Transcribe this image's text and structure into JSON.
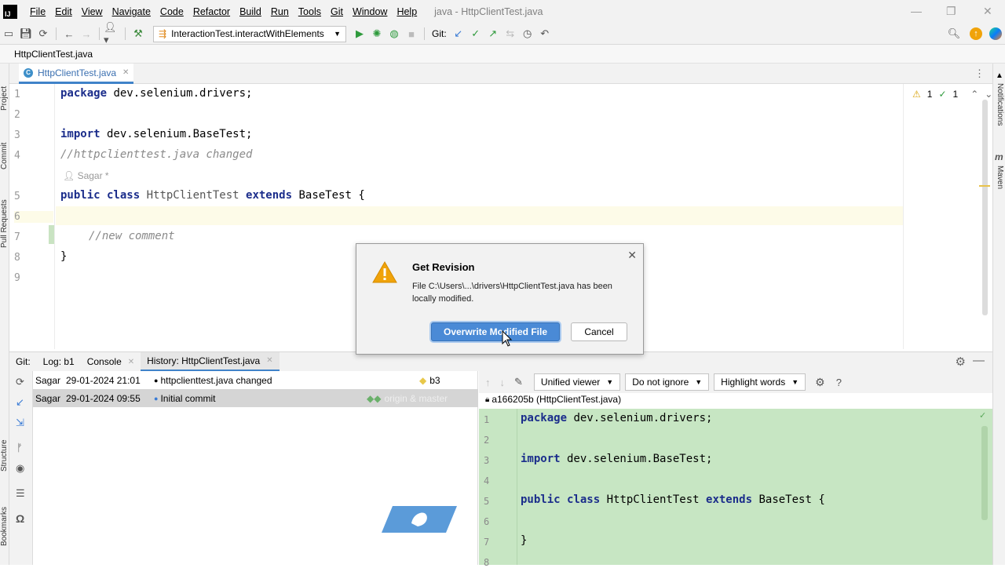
{
  "menubar": {
    "logo": "IJ",
    "items": [
      "File",
      "Edit",
      "View",
      "Navigate",
      "Code",
      "Refactor",
      "Build",
      "Run",
      "Tools",
      "Git",
      "Window",
      "Help"
    ],
    "window_title": "java - HttpClientTest.java"
  },
  "toolbar": {
    "run_config": "InteractionTest.interactWithElements",
    "git_label": "Git:"
  },
  "breadcrumb": {
    "file": "HttpClientTest.java"
  },
  "editor_tab": {
    "label": "HttpClientTest.java",
    "icon_letter": "C"
  },
  "side_labels": {
    "left": [
      "Project",
      "Commit",
      "Pull Requests",
      "Structure",
      "Bookmarks"
    ],
    "right": [
      "Notifications",
      "Maven"
    ]
  },
  "inspection": {
    "warnings": "1",
    "ok": "1"
  },
  "editor": {
    "lines": [
      "1",
      "2",
      "3",
      "4",
      "5",
      "6",
      "7",
      "8",
      "9"
    ],
    "code": {
      "l1_kw": "package",
      "l1_rest": " dev.selenium.drivers;",
      "l3_kw": "import",
      "l3_rest": " dev.selenium.BaseTest;",
      "l4": "//httpclienttest.java changed",
      "author": "Sagar *",
      "l5_kw1": "public class",
      "l5_cls": " HttpClientTest ",
      "l5_kw2": "extends",
      "l5_rest": " BaseTest {",
      "l7": "//new comment",
      "l8": "}"
    }
  },
  "dialog": {
    "title": "Get Revision",
    "message_line1": "File C:\\Users\\...\\drivers\\HttpClientTest.java has been",
    "message_line2": "locally modified.",
    "primary_button": "Overwrite Modified File",
    "cancel_button": "Cancel"
  },
  "bottom_tabs": {
    "git_prefix": "Git:",
    "tabs": [
      "Log: b1",
      "Console",
      "History: HttpClientTest.java"
    ]
  },
  "history": {
    "rows": [
      {
        "author": "Sagar",
        "date": "29-01-2024 21:01",
        "message": "httpclienttest.java changed",
        "branch": "b3"
      },
      {
        "author": "Sagar",
        "date": "29-01-2024 09:55",
        "message": "Initial commit",
        "branch": "origin & master"
      }
    ]
  },
  "diff": {
    "viewer": "Unified viewer",
    "ignore": "Do not ignore",
    "highlight": "Highlight words",
    "header": "a166205b (HttpClientTest.java)",
    "lines": [
      "1",
      "2",
      "3",
      "4",
      "5",
      "6",
      "7",
      "8"
    ],
    "code": {
      "l1_kw": "package",
      "l1_rest": " dev.selenium.drivers;",
      "l3_kw": "import",
      "l3_rest": " dev.selenium.BaseTest;",
      "l5_kw1": "public class",
      "l5_cls": " HttpClientTest ",
      "l5_kw2": "extends",
      "l5_rest": " BaseTest {",
      "l7": "}"
    }
  }
}
